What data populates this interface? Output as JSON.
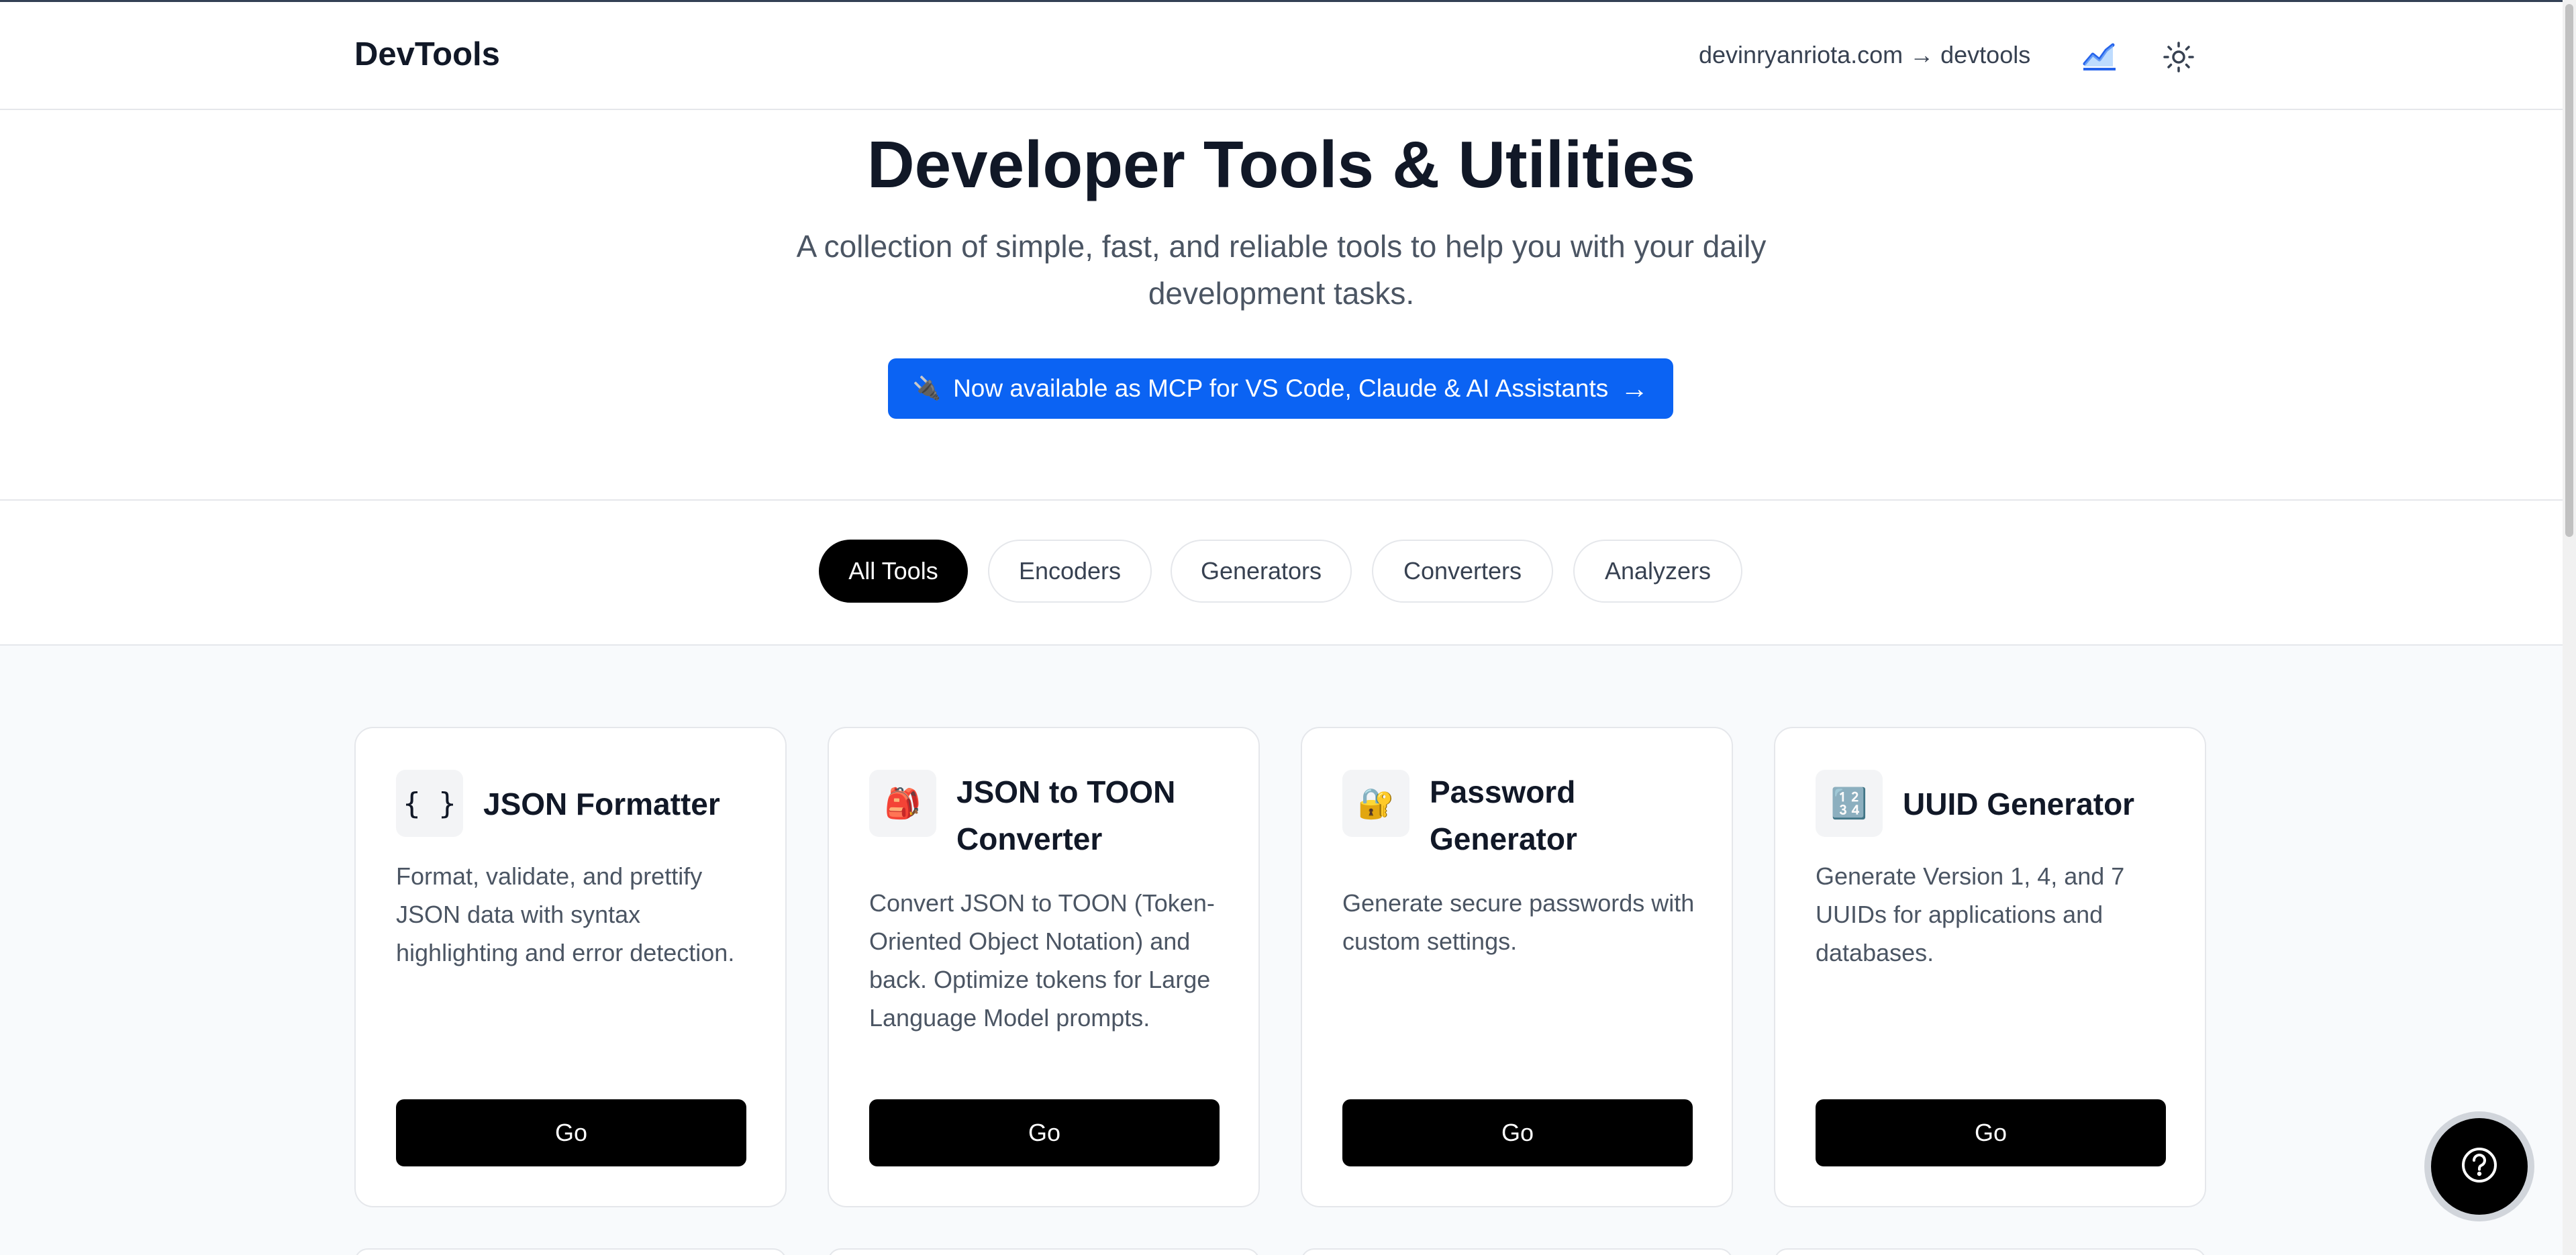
{
  "header": {
    "brand": "DevTools",
    "link_text": "devinryanriota.com → devtools",
    "analytics_icon": "line-chart-icon",
    "theme_icon": "sun-icon"
  },
  "hero": {
    "title": "Developer Tools & Utilities",
    "subtitle": "A collection of simple, fast, and reliable tools to help you with your daily development tasks.",
    "mcp_button": {
      "icon": "🔌",
      "label": "Now available as MCP for VS Code, Claude & AI Assistants",
      "arrow": "→"
    }
  },
  "filters": [
    {
      "label": "All Tools",
      "active": true
    },
    {
      "label": "Encoders",
      "active": false
    },
    {
      "label": "Generators",
      "active": false
    },
    {
      "label": "Converters",
      "active": false
    },
    {
      "label": "Analyzers",
      "active": false
    }
  ],
  "tools": [
    {
      "icon_name": "braces-icon",
      "icon": "{ }",
      "title": "JSON Formatter",
      "description": "Format, validate, and prettify JSON data with syntax highlighting and error detection.",
      "button": "Go"
    },
    {
      "icon_name": "backpack-icon",
      "icon": "🎒",
      "title": "JSON to TOON Converter",
      "description": "Convert JSON to TOON (Token-Oriented Object Notation) and back. Optimize tokens for Large Language Model prompts.",
      "button": "Go"
    },
    {
      "icon_name": "lock-key-icon",
      "icon": "🔐",
      "title": "Password Generator",
      "description": "Generate secure passwords with custom settings.",
      "button": "Go"
    },
    {
      "icon_name": "numbers-icon",
      "icon": "🔢",
      "title": "UUID Generator",
      "description": "Generate Version 1, 4, and 7 UUIDs for applications and databases.",
      "button": "Go"
    }
  ],
  "help_button": {
    "icon": "help-circle-icon"
  },
  "colors": {
    "accent": "#0b63f3",
    "primary_button": "#000000",
    "page_background": "#f8fafc"
  }
}
